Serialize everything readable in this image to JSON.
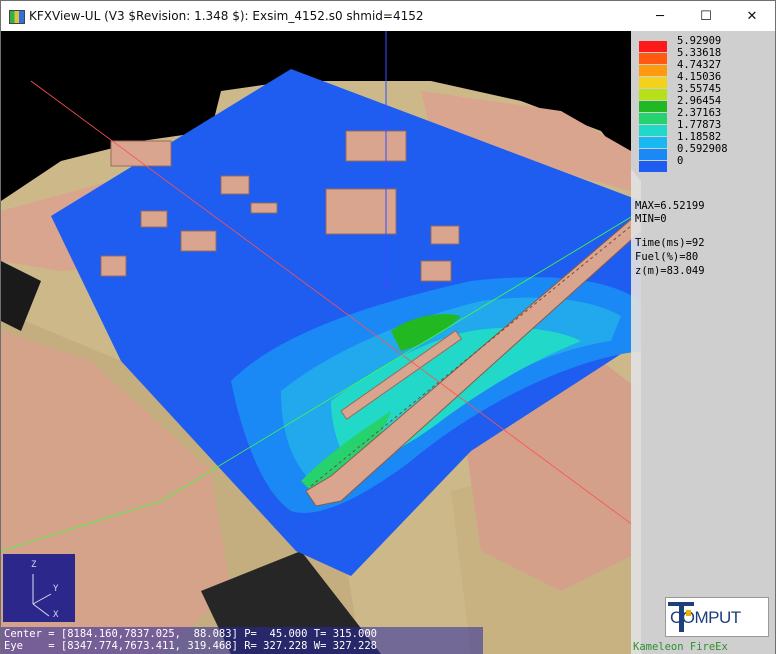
{
  "window": {
    "title": "KFXView-UL (V3 $Revision: 1.348 $): Exsim_4152.s0 shmid=4152",
    "controls": {
      "minimize": "─",
      "maximize": "☐",
      "close": "✕"
    }
  },
  "legend": {
    "bins": [
      {
        "label": "5.92909",
        "color": "#ff1a1a"
      },
      {
        "label": "5.33618",
        "color": "#ff5a10"
      },
      {
        "label": "4.74327",
        "color": "#ff9a10"
      },
      {
        "label": "4.15036",
        "color": "#f2d21a"
      },
      {
        "label": "3.55745",
        "color": "#b8e01a"
      },
      {
        "label": "2.96454",
        "color": "#22b822"
      },
      {
        "label": "2.37163",
        "color": "#26d26e"
      },
      {
        "label": "1.77873",
        "color": "#22d8c8"
      },
      {
        "label": "1.18582",
        "color": "#1ab8f0"
      },
      {
        "label": "0.592908",
        "color": "#1a88f5"
      },
      {
        "label": "0",
        "color": "#1f5cf0"
      }
    ],
    "max_line": "MAX=6.52199",
    "min_line": "MIN=0",
    "time_line": "Time(ms)=92",
    "fuel_line": "Fuel(%)=80",
    "z_line": "z(m)=83.049"
  },
  "axes": {
    "z": "Z",
    "y": "Y",
    "x": "X"
  },
  "status": {
    "center_line": "Center = [8184.160,7837.025,  88.083] P=  45.000 T= 315.000",
    "eye_line": "Eye    = [8347.774,7673.411, 319.468] R= 327.228 W= 327.228"
  },
  "brand": {
    "logo_text": "COMPUT",
    "product": "Kameleon FireEx"
  },
  "colors": {
    "field_base": "#1f5cf0",
    "structure_pink": "#d9a58f",
    "ground_tan": "#cdb88a",
    "window_bg": "#000000"
  }
}
